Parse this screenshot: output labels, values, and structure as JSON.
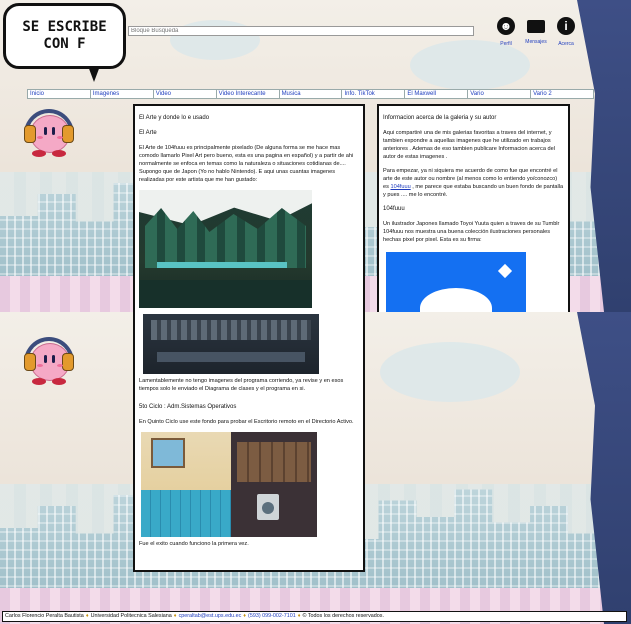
{
  "header": {
    "logo_line1": "SE ESCRIBE",
    "logo_line2": "CON F",
    "search_placeholder": "Bloque Busqueda",
    "icons": [
      {
        "name": "user-icon",
        "label": "Perfil"
      },
      {
        "name": "mail-icon",
        "label": "Mensajes"
      },
      {
        "name": "info-icon",
        "label": "Acerca"
      }
    ]
  },
  "nav": {
    "items": [
      "Inicio",
      "Imagenes",
      "Video",
      "Video Interecante",
      "Musica",
      "Info. TikTok",
      "El Maxwell",
      "Vario",
      "Vario 2"
    ]
  },
  "colors": {
    "link": "#1f3dbe",
    "footer_separator": "#c79417",
    "accent_blue": "#1470f2"
  },
  "left_panel": {
    "section1_title": "El Arte y donde lo e usado",
    "section1_subtitle": "El Arte",
    "section1_text": "El Arte de 104fuuu es principalmente pixelado (De alguna forma se me hace mas comodo llamarlo Pixel Art pero bueno, esta es una pagina en español) y a partir de ahi normalmente se enfoca en temas como la naturaleza o situaciones cotidianas de.... Supongo que de Japon (Yo no hablo Nintendo). E aqui unas cuantas imagenes realizadas por este artista que me han gustado:",
    "caption_program": "Lamentablemente no tengo imagenes del programa corriendo, ya revise y en esos tiempos solo le enviado el Diagrama de clases y el programa en si.",
    "section2_title": "5to Ciclo : Adm.Sistemas Operativos",
    "section2_text": "En Quinto Ciclo use este fondo para probar el Escritorio remoto en el Directorio Activo.",
    "caption_room": "Fue el exito cuando funciono la primera vez."
  },
  "right_panel": {
    "title": "Informacion acerca de la galeria y su autor",
    "intro_text": "Aqui compartiré una de mis galerias favoritas a traves del internet, y tambien expondre a aquellas imagenes que he utilizado en trabajos anteriores . Ademas de eso tambien publicare Informacion acerca del autor de estas imagenes .",
    "para2_before_link": "Para empezar, ya ni siquiera me acuerdo de como fue que encontré el arte de este autor ou nombre (al menos como lo entiendo yo/conozco) es ",
    "para2_link": "104fuuu",
    "para2_after_link": " , me parece que estaba buscando un buen fondo de pantalla y pues .... me lo encontré.",
    "subtitle": "104fuuu",
    "author_text": "Un ilustrador Japones llamado Toyoi Yuuta quien a traves de su Tumblr 104fuuu nos muestra una buena colección ilustraciones personales hechas pixel por pixel. Esta es su firma:"
  },
  "footer": {
    "parts": [
      "Carlos Florencio Peralta Bautista",
      "Universidad Politecnica Salesiana",
      "cperaltab@est.ups.edu.ec",
      "(593) 099-002-7101",
      "Todos los derechos reservados."
    ]
  }
}
